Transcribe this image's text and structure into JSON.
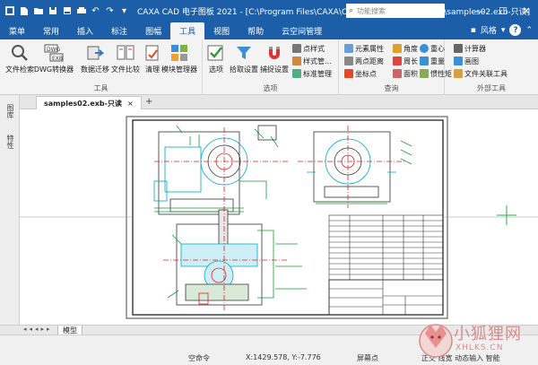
{
  "titlebar": {
    "title": "CAXA CAD 电子图板 2021 - [C:\\Program Files\\CAXA\\CAXA CAD\\2021\\Samples\\samples02.exb-只读]",
    "search_placeholder": "功能搜索",
    "minimize": "—",
    "maximize": "☐",
    "close": "✕"
  },
  "menu": {
    "tabs": [
      "菜单",
      "常用",
      "插入",
      "标注",
      "图幅",
      "工具",
      "视图",
      "帮助",
      "云空间管理"
    ],
    "active_tab": "工具",
    "style_label": "风格",
    "help_icon_text": "?"
  },
  "ribbon": {
    "groups": {
      "tools": {
        "title": "工具",
        "buttons": [
          "文件检索",
          "DWG转换器",
          "数据迁移",
          "文件比较",
          "清理",
          "模块管理器"
        ]
      },
      "options": {
        "title": "选项",
        "buttons": [
          "选项",
          "拾取设置",
          "捕捉设置"
        ],
        "small": [
          "点样式",
          "样式管...",
          "标准管理"
        ]
      },
      "query": {
        "title": "查询",
        "small": [
          "元素属性",
          "角度",
          "重心",
          "两点距离",
          "周长",
          "重量",
          "坐标点",
          "面积",
          "惯性矩"
        ]
      },
      "external": {
        "title": "外部工具",
        "small": [
          "计算器",
          "画图",
          "文件关联工具"
        ]
      }
    }
  },
  "sidepanel": {
    "tabs": [
      "图库",
      "特性"
    ]
  },
  "document": {
    "tab_label": "samples02.exb-只读",
    "close": "×",
    "add": "+"
  },
  "modelbar": {
    "nav": "◂◂◂▸▸",
    "tab": "模型"
  },
  "status": {
    "command": "空命令",
    "coords": "X:1429.578, Y:-7.776",
    "snap": "屏幕点",
    "right": "正交 线宽 动态输入 智能"
  },
  "watermark": {
    "brand": "小狐狸网",
    "url": "XHLKS.CN"
  },
  "colors": {
    "titlebar": "#1c5fa8",
    "ribbon_bg": "#f3f3f3",
    "drawing_cyan": "#00a8c8",
    "drawing_red": "#e02020",
    "drawing_green": "#1a9a3a",
    "crosshair": "#2ea84a"
  }
}
